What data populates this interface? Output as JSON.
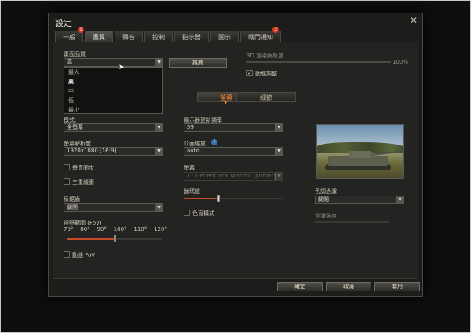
{
  "window": {
    "title": "設定",
    "close_glyph": "✕"
  },
  "tabs": [
    {
      "label": "一般",
      "badge": "1"
    },
    {
      "label": "畫質",
      "badge": ""
    },
    {
      "label": "聲音",
      "badge": ""
    },
    {
      "label": "控制",
      "badge": ""
    },
    {
      "label": "指示器",
      "badge": ""
    },
    {
      "label": "圖示",
      "badge": ""
    },
    {
      "label": "戰鬥通知",
      "badge": "3"
    }
  ],
  "graphics": {
    "quality_label": "畫面品質",
    "quality_value": "高",
    "quality_options": [
      "最大",
      "高",
      "中",
      "低",
      "最小"
    ],
    "recommend_button": "推薦",
    "render_res_label": "3D 渲染解析度",
    "render_res_value": "100%",
    "render_res_fraction": 1.0,
    "dynamic_label": "動態調整",
    "dynamic_checked": true
  },
  "subtabs": {
    "screen": "螢幕",
    "details": "細節"
  },
  "screen": {
    "mode_label": "模式:",
    "mode_value": "全螢幕",
    "resolution_label": "螢幕解析度",
    "resolution_value": "1920x1080 [16:9]",
    "vsync_label": "垂直同步",
    "triple_buffer_label": "三重緩衝",
    "aa_label": "反鋸齒",
    "aa_value": "關閉",
    "fov_label": "視野範圍 (FoV)",
    "fov_ticks": [
      "70°",
      "80°",
      "90°",
      "100°",
      "110°",
      "120°"
    ],
    "fov_value": 95,
    "fov_min": 70,
    "fov_max": 120,
    "dynamic_fov_label": "動態 FoV",
    "refresh_label": "顯示器更新頻率",
    "refresh_value": "59",
    "ui_scale_label": "介面縮放",
    "ui_scale_value": "auto",
    "ui_scale_info": "i",
    "monitor_label": "螢幕",
    "monitor_value": "1 : Generic PnP Monitor (primary)",
    "gamma_label": "伽瑪值",
    "gamma_fraction": 0.35,
    "colorblind_label": "色盲模式",
    "color_filter_label": "色調過濾",
    "color_filter_value": "關閉",
    "filter_strength_label": "過濾強度"
  },
  "footer": {
    "ok": "確定",
    "cancel": "取消",
    "apply": "套用"
  },
  "colors": {
    "accent": "#ff8a2a",
    "slider_fill": "#c44b2a",
    "badge": "#d13a20"
  }
}
